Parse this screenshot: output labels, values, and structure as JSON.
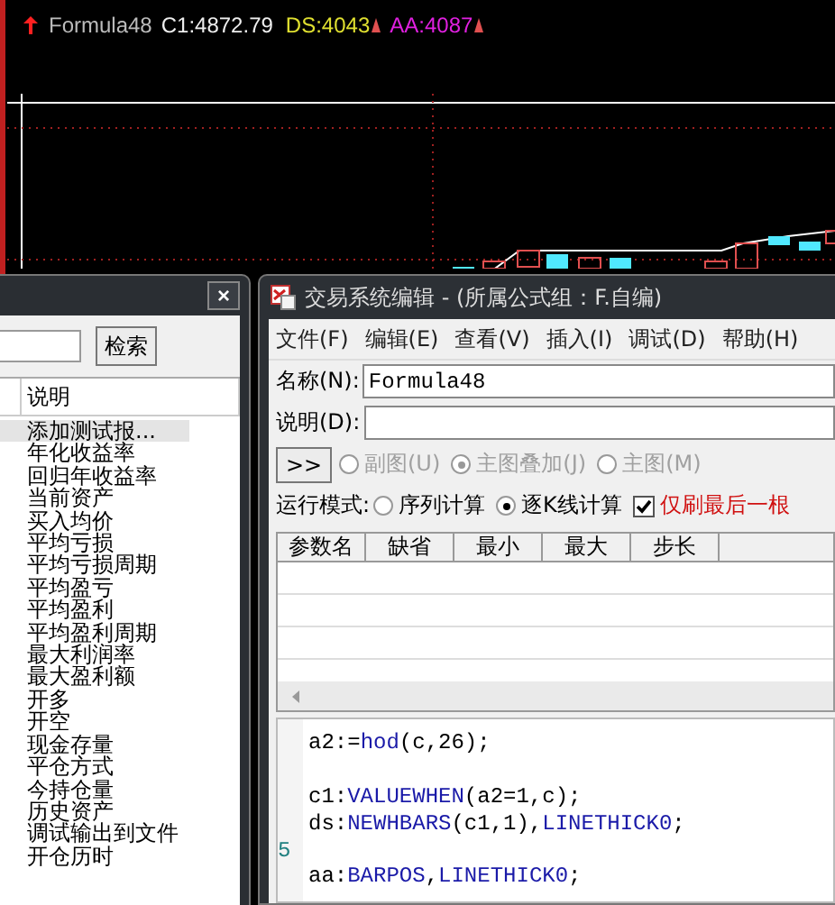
{
  "chart": {
    "legend": {
      "formula": "Formula48",
      "c1": "C1:4872.79",
      "ds": "DS:4043",
      "aa": "AA:4087"
    }
  },
  "left_panel": {
    "close": "×",
    "search_button": "检索",
    "column": "说明",
    "items": [
      {
        "label": "添加测试报...",
        "selected": true
      },
      {
        "label": "年化收益率",
        "selected": false
      },
      {
        "label": "回归年收益率",
        "selected": false
      },
      {
        "label": "当前资产",
        "selected": false
      },
      {
        "label": "买入均价",
        "selected": false
      },
      {
        "label": "平均亏损",
        "selected": false
      },
      {
        "label": "平均亏损周期",
        "selected": false
      },
      {
        "label": "平均盈亏",
        "selected": false
      },
      {
        "label": "平均盈利",
        "selected": false
      },
      {
        "label": "平均盈利周期",
        "selected": false
      },
      {
        "label": "最大利润率",
        "selected": false
      },
      {
        "label": "最大盈利额",
        "selected": false
      },
      {
        "label": "开多",
        "selected": false
      },
      {
        "label": "开空",
        "selected": false
      },
      {
        "label": "现金存量",
        "selected": false
      },
      {
        "label": "平仓方式",
        "selected": false
      },
      {
        "label": "今持仓量",
        "selected": false
      },
      {
        "label": "历史资产",
        "selected": false
      },
      {
        "label": "调试输出到文件",
        "selected": false
      },
      {
        "label": "开仓历时",
        "selected": false
      }
    ]
  },
  "editor": {
    "title": "交易系统编辑 - (所属公式组：F.自编)",
    "menu": [
      "文件(F)",
      "编辑(E)",
      "查看(V)",
      "插入(I)",
      "调试(D)",
      "帮助(H)"
    ],
    "name_label": "名称(N):",
    "name_value": "Formula48",
    "desc_label": "说明(D):",
    "expand_button": ">>",
    "chart_types": [
      {
        "label": "副图(U)",
        "selected": false,
        "disabled": true
      },
      {
        "label": "主图叠加(J)",
        "selected": true,
        "disabled": true
      },
      {
        "label": "主图(M)",
        "selected": false,
        "disabled": true
      }
    ],
    "run_mode_label": "运行模式:",
    "run_modes": [
      {
        "label": "序列计算",
        "selected": false
      },
      {
        "label": "逐K线计算",
        "selected": true
      }
    ],
    "refresh_option": {
      "label": "仅刷最后一根",
      "checked": true
    },
    "params": {
      "columns": [
        "参数名",
        "缺省",
        "最小",
        "最大",
        "步长"
      ]
    },
    "code": [
      {
        "kind": "code",
        "text": "a2:=**hod**(c,26);"
      },
      {
        "kind": "blank"
      },
      {
        "kind": "code",
        "text": "c1:**VALUEWHEN**(a2=1,c);"
      },
      {
        "kind": "code",
        "text": "ds:**NEWHBARS**(c1,1),**LINETHICK0**;"
      },
      {
        "kind": "blank",
        "number": "5"
      },
      {
        "kind": "code",
        "text": "aa:**BARPOS**,**LINETHICK0**;"
      }
    ]
  }
}
